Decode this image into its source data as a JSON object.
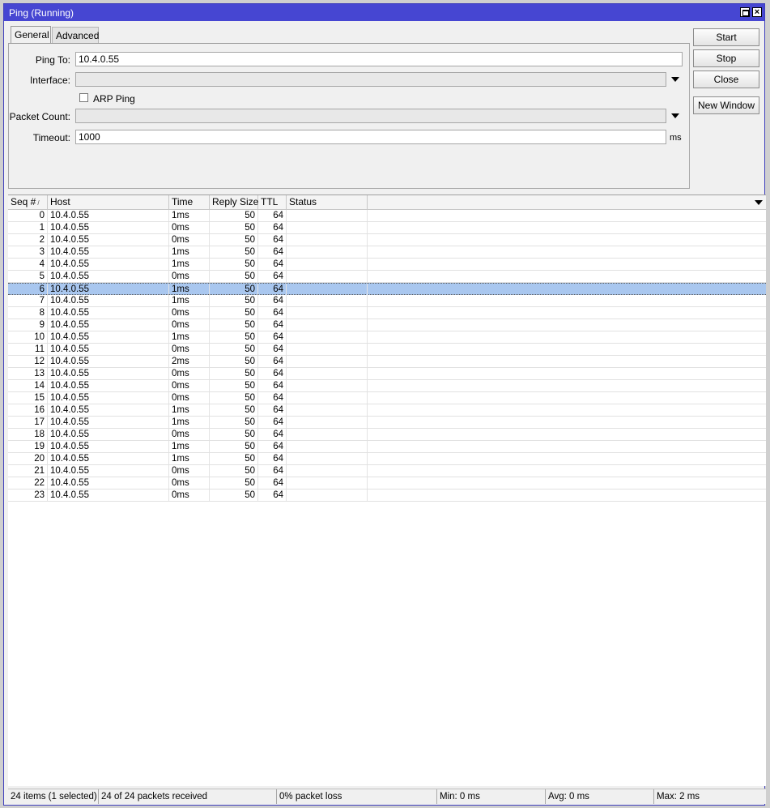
{
  "window": {
    "title": "Ping (Running)"
  },
  "tabs": [
    {
      "label": "General"
    },
    {
      "label": "Advanced"
    }
  ],
  "form": {
    "ping_to": {
      "label": "Ping To:",
      "value": "10.4.0.55"
    },
    "interface": {
      "label": "Interface:",
      "value": ""
    },
    "arp_ping": {
      "label": "ARP Ping",
      "checked": false
    },
    "packet_count": {
      "label": "Packet Count:",
      "value": ""
    },
    "timeout": {
      "label": "Timeout:",
      "value": "1000",
      "unit": "ms"
    }
  },
  "buttons": {
    "start": "Start",
    "stop": "Stop",
    "close": "Close",
    "new_window": "New Window"
  },
  "table": {
    "columns": [
      "Seq #",
      "Host",
      "Time",
      "Reply Size",
      "TTL",
      "Status"
    ],
    "sort_column": "Seq #",
    "selected_index": 6,
    "rows": [
      {
        "seq": "0",
        "host": "10.4.0.55",
        "time": "1ms",
        "size": "50",
        "ttl": "64",
        "status": ""
      },
      {
        "seq": "1",
        "host": "10.4.0.55",
        "time": "0ms",
        "size": "50",
        "ttl": "64",
        "status": ""
      },
      {
        "seq": "2",
        "host": "10.4.0.55",
        "time": "0ms",
        "size": "50",
        "ttl": "64",
        "status": ""
      },
      {
        "seq": "3",
        "host": "10.4.0.55",
        "time": "1ms",
        "size": "50",
        "ttl": "64",
        "status": ""
      },
      {
        "seq": "4",
        "host": "10.4.0.55",
        "time": "1ms",
        "size": "50",
        "ttl": "64",
        "status": ""
      },
      {
        "seq": "5",
        "host": "10.4.0.55",
        "time": "0ms",
        "size": "50",
        "ttl": "64",
        "status": ""
      },
      {
        "seq": "6",
        "host": "10.4.0.55",
        "time": "1ms",
        "size": "50",
        "ttl": "64",
        "status": ""
      },
      {
        "seq": "7",
        "host": "10.4.0.55",
        "time": "1ms",
        "size": "50",
        "ttl": "64",
        "status": ""
      },
      {
        "seq": "8",
        "host": "10.4.0.55",
        "time": "0ms",
        "size": "50",
        "ttl": "64",
        "status": ""
      },
      {
        "seq": "9",
        "host": "10.4.0.55",
        "time": "0ms",
        "size": "50",
        "ttl": "64",
        "status": ""
      },
      {
        "seq": "10",
        "host": "10.4.0.55",
        "time": "1ms",
        "size": "50",
        "ttl": "64",
        "status": ""
      },
      {
        "seq": "11",
        "host": "10.4.0.55",
        "time": "0ms",
        "size": "50",
        "ttl": "64",
        "status": ""
      },
      {
        "seq": "12",
        "host": "10.4.0.55",
        "time": "2ms",
        "size": "50",
        "ttl": "64",
        "status": ""
      },
      {
        "seq": "13",
        "host": "10.4.0.55",
        "time": "0ms",
        "size": "50",
        "ttl": "64",
        "status": ""
      },
      {
        "seq": "14",
        "host": "10.4.0.55",
        "time": "0ms",
        "size": "50",
        "ttl": "64",
        "status": ""
      },
      {
        "seq": "15",
        "host": "10.4.0.55",
        "time": "0ms",
        "size": "50",
        "ttl": "64",
        "status": ""
      },
      {
        "seq": "16",
        "host": "10.4.0.55",
        "time": "1ms",
        "size": "50",
        "ttl": "64",
        "status": ""
      },
      {
        "seq": "17",
        "host": "10.4.0.55",
        "time": "1ms",
        "size": "50",
        "ttl": "64",
        "status": ""
      },
      {
        "seq": "18",
        "host": "10.4.0.55",
        "time": "0ms",
        "size": "50",
        "ttl": "64",
        "status": ""
      },
      {
        "seq": "19",
        "host": "10.4.0.55",
        "time": "1ms",
        "size": "50",
        "ttl": "64",
        "status": ""
      },
      {
        "seq": "20",
        "host": "10.4.0.55",
        "time": "1ms",
        "size": "50",
        "ttl": "64",
        "status": ""
      },
      {
        "seq": "21",
        "host": "10.4.0.55",
        "time": "0ms",
        "size": "50",
        "ttl": "64",
        "status": ""
      },
      {
        "seq": "22",
        "host": "10.4.0.55",
        "time": "0ms",
        "size": "50",
        "ttl": "64",
        "status": ""
      },
      {
        "seq": "23",
        "host": "10.4.0.55",
        "time": "0ms",
        "size": "50",
        "ttl": "64",
        "status": ""
      }
    ]
  },
  "status_bar": {
    "items": "24 items (1 selected)",
    "received": "24 of 24 packets received",
    "loss": "0% packet loss",
    "min": "Min: 0 ms",
    "avg": "Avg: 0 ms",
    "max": "Max: 2 ms"
  },
  "colors": {
    "titlebar": "#4646d2",
    "selected_row": "#a9c7ef"
  }
}
